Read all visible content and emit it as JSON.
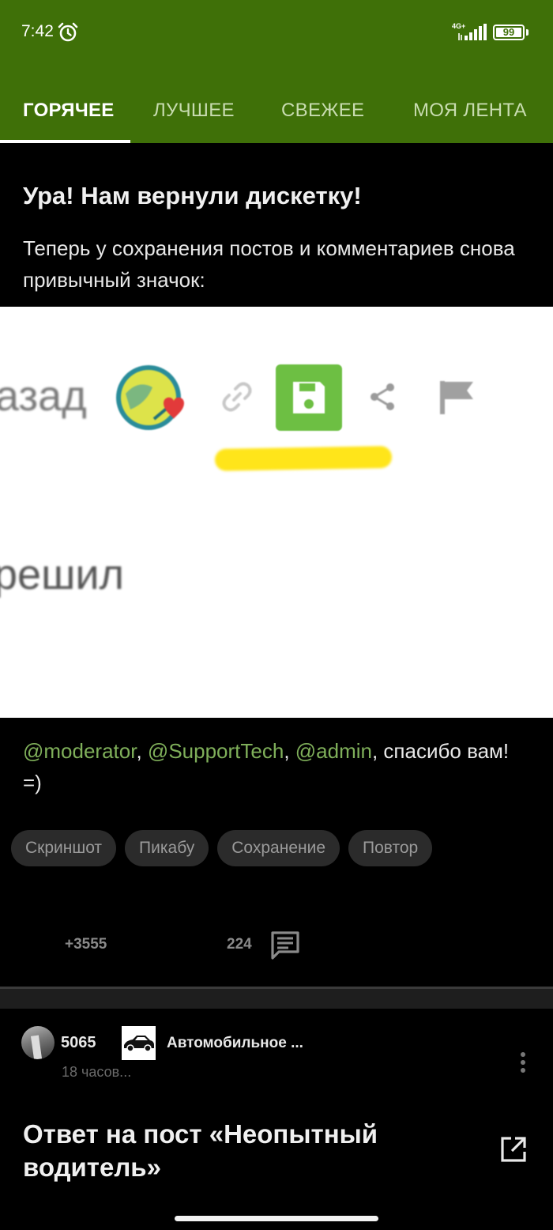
{
  "status_bar": {
    "time": "7:42",
    "network": "4G+",
    "battery": "99"
  },
  "tabs": [
    {
      "label": "ГОРЯЧЕЕ",
      "active": true
    },
    {
      "label": "ЛУЧШЕЕ",
      "active": false
    },
    {
      "label": "СВЕЖЕЕ",
      "active": false
    },
    {
      "label": "МОЯ ЛЕНТА",
      "active": false
    }
  ],
  "post": {
    "title": "Ура! Нам вернули дискетку!",
    "text": "Теперь у сохранения постов и комментариев снова привычный значок:",
    "image": {
      "word_top": "азад",
      "word_bottom": "решил"
    },
    "mentions": [
      "@moderator",
      "@SupportTech",
      "@admin"
    ],
    "separator": ", ",
    "thanks_text": ", спасибо вам! =)",
    "tags": [
      "Скриншот",
      "Пикабу",
      "Сохранение",
      "Повтор"
    ],
    "rating": "+3555",
    "comments": "224"
  },
  "next_post": {
    "author_rating": "5065",
    "community": "Автомобильное ...",
    "time": "18 часов...",
    "title": "Ответ на пост «Неопытный водитель»"
  },
  "colors": {
    "header": "#3f7008",
    "mention": "#7faf5a",
    "save_button": "#6dbf43",
    "highlight": "#ffe51a"
  }
}
